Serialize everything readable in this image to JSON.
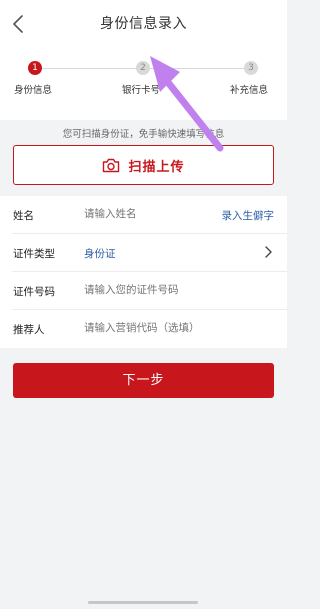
{
  "header": {
    "title": "身份信息录入"
  },
  "steps": [
    {
      "number": "1",
      "label": "身份信息",
      "state": "active"
    },
    {
      "number": "2",
      "label": "银行卡号",
      "state": "inactive"
    },
    {
      "number": "3",
      "label": "补充信息",
      "state": "inactive"
    }
  ],
  "scan": {
    "hint": "您可扫描身份证，免手输快速填写信息",
    "button_label": "扫描上传"
  },
  "form": {
    "name": {
      "label": "姓名",
      "placeholder": "请输入姓名",
      "action": "录入生僻字"
    },
    "id_type": {
      "label": "证件类型",
      "value": "身份证"
    },
    "id_number": {
      "label": "证件号码",
      "placeholder": "请输入您的证件号码"
    },
    "referrer": {
      "label": "推荐人",
      "placeholder": "请输入营销代码（选填）"
    }
  },
  "next_button": {
    "label": "下一步"
  },
  "colors": {
    "brand_red": "#c8161d",
    "link_blue": "#2a5ea8",
    "annotation_arrow": "#c080ee"
  },
  "icons": {
    "back": "chevron-left-icon",
    "camera": "camera-icon",
    "chevron": "chevron-right-icon"
  }
}
